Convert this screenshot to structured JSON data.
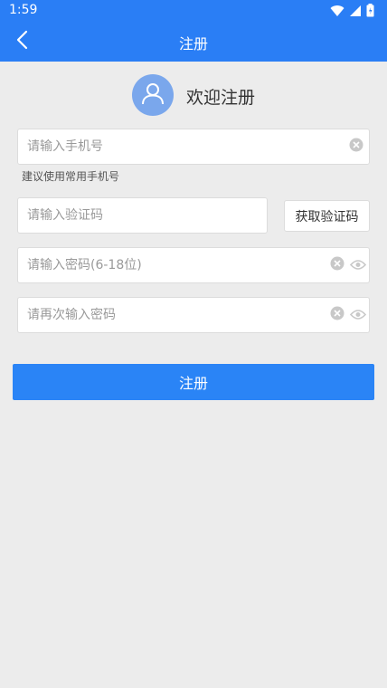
{
  "status_bar": {
    "time": "1:59"
  },
  "app_bar": {
    "title": "注册"
  },
  "welcome": {
    "text": "欢迎注册"
  },
  "form": {
    "phone": {
      "placeholder": "请输入手机号",
      "value": ""
    },
    "phone_hint": "建议使用常用手机号",
    "code": {
      "placeholder": "请输入验证码",
      "value": ""
    },
    "get_code_label": "获取验证码",
    "password": {
      "placeholder": "请输入密码(6-18位)",
      "value": ""
    },
    "confirm_password": {
      "placeholder": "请再次输入密码",
      "value": ""
    },
    "submit_label": "注册"
  },
  "colors": {
    "primary": "#2a7ef5",
    "background": "#ececec",
    "avatar": "#7aa7ec"
  },
  "icons": [
    "back-arrow-icon",
    "user-icon",
    "clear-icon",
    "eye-icon",
    "wifi-icon",
    "signal-icon",
    "battery-icon"
  ]
}
